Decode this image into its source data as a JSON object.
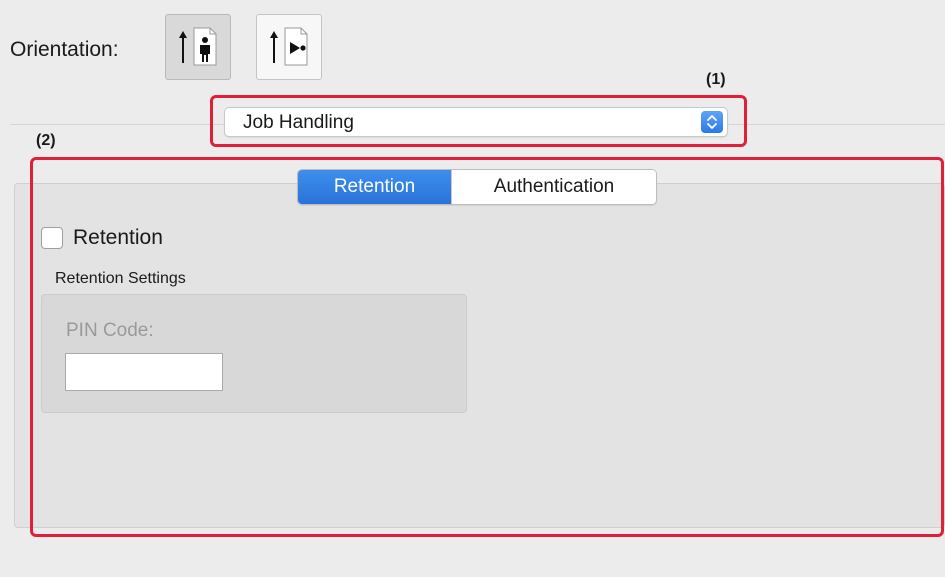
{
  "orientation": {
    "label": "Orientation:",
    "options": [
      {
        "icon": "portrait-orientation-icon",
        "selected": true
      },
      {
        "icon": "landscape-orientation-icon",
        "selected": false
      }
    ]
  },
  "callouts": {
    "one": "(1)",
    "two": "(2)"
  },
  "popup": {
    "selected": "Job Handling",
    "icon": "up-down-chevron-icon"
  },
  "tabs": [
    {
      "label": "Retention",
      "active": true
    },
    {
      "label": "Authentication",
      "active": false
    }
  ],
  "retention": {
    "checkbox_label": "Retention",
    "checked": false,
    "settings_title": "Retention Settings",
    "pin_label": "PIN Code:",
    "pin_value": ""
  },
  "colors": {
    "accent": "#2a72d9",
    "highlight": "#e0203a"
  }
}
